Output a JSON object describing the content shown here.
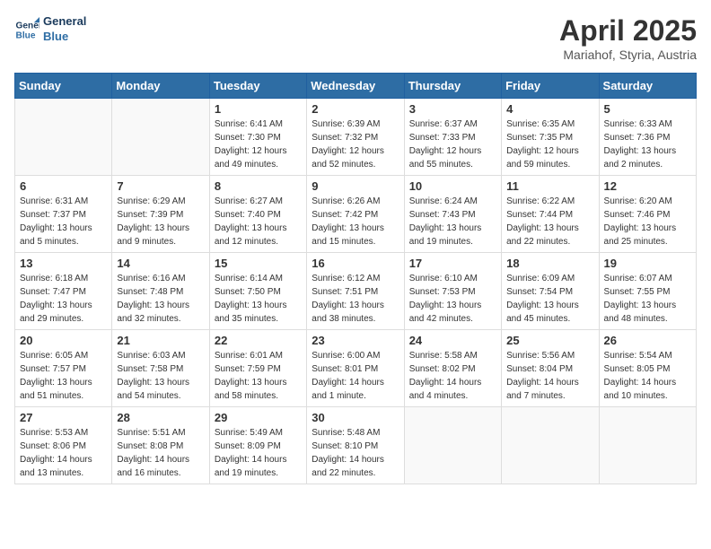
{
  "header": {
    "logo_line1": "General",
    "logo_line2": "Blue",
    "month": "April 2025",
    "location": "Mariahof, Styria, Austria"
  },
  "weekdays": [
    "Sunday",
    "Monday",
    "Tuesday",
    "Wednesday",
    "Thursday",
    "Friday",
    "Saturday"
  ],
  "weeks": [
    [
      {
        "day": "",
        "info": ""
      },
      {
        "day": "",
        "info": ""
      },
      {
        "day": "1",
        "info": "Sunrise: 6:41 AM\nSunset: 7:30 PM\nDaylight: 12 hours\nand 49 minutes."
      },
      {
        "day": "2",
        "info": "Sunrise: 6:39 AM\nSunset: 7:32 PM\nDaylight: 12 hours\nand 52 minutes."
      },
      {
        "day": "3",
        "info": "Sunrise: 6:37 AM\nSunset: 7:33 PM\nDaylight: 12 hours\nand 55 minutes."
      },
      {
        "day": "4",
        "info": "Sunrise: 6:35 AM\nSunset: 7:35 PM\nDaylight: 12 hours\nand 59 minutes."
      },
      {
        "day": "5",
        "info": "Sunrise: 6:33 AM\nSunset: 7:36 PM\nDaylight: 13 hours\nand 2 minutes."
      }
    ],
    [
      {
        "day": "6",
        "info": "Sunrise: 6:31 AM\nSunset: 7:37 PM\nDaylight: 13 hours\nand 5 minutes."
      },
      {
        "day": "7",
        "info": "Sunrise: 6:29 AM\nSunset: 7:39 PM\nDaylight: 13 hours\nand 9 minutes."
      },
      {
        "day": "8",
        "info": "Sunrise: 6:27 AM\nSunset: 7:40 PM\nDaylight: 13 hours\nand 12 minutes."
      },
      {
        "day": "9",
        "info": "Sunrise: 6:26 AM\nSunset: 7:42 PM\nDaylight: 13 hours\nand 15 minutes."
      },
      {
        "day": "10",
        "info": "Sunrise: 6:24 AM\nSunset: 7:43 PM\nDaylight: 13 hours\nand 19 minutes."
      },
      {
        "day": "11",
        "info": "Sunrise: 6:22 AM\nSunset: 7:44 PM\nDaylight: 13 hours\nand 22 minutes."
      },
      {
        "day": "12",
        "info": "Sunrise: 6:20 AM\nSunset: 7:46 PM\nDaylight: 13 hours\nand 25 minutes."
      }
    ],
    [
      {
        "day": "13",
        "info": "Sunrise: 6:18 AM\nSunset: 7:47 PM\nDaylight: 13 hours\nand 29 minutes."
      },
      {
        "day": "14",
        "info": "Sunrise: 6:16 AM\nSunset: 7:48 PM\nDaylight: 13 hours\nand 32 minutes."
      },
      {
        "day": "15",
        "info": "Sunrise: 6:14 AM\nSunset: 7:50 PM\nDaylight: 13 hours\nand 35 minutes."
      },
      {
        "day": "16",
        "info": "Sunrise: 6:12 AM\nSunset: 7:51 PM\nDaylight: 13 hours\nand 38 minutes."
      },
      {
        "day": "17",
        "info": "Sunrise: 6:10 AM\nSunset: 7:53 PM\nDaylight: 13 hours\nand 42 minutes."
      },
      {
        "day": "18",
        "info": "Sunrise: 6:09 AM\nSunset: 7:54 PM\nDaylight: 13 hours\nand 45 minutes."
      },
      {
        "day": "19",
        "info": "Sunrise: 6:07 AM\nSunset: 7:55 PM\nDaylight: 13 hours\nand 48 minutes."
      }
    ],
    [
      {
        "day": "20",
        "info": "Sunrise: 6:05 AM\nSunset: 7:57 PM\nDaylight: 13 hours\nand 51 minutes."
      },
      {
        "day": "21",
        "info": "Sunrise: 6:03 AM\nSunset: 7:58 PM\nDaylight: 13 hours\nand 54 minutes."
      },
      {
        "day": "22",
        "info": "Sunrise: 6:01 AM\nSunset: 7:59 PM\nDaylight: 13 hours\nand 58 minutes."
      },
      {
        "day": "23",
        "info": "Sunrise: 6:00 AM\nSunset: 8:01 PM\nDaylight: 14 hours\nand 1 minute."
      },
      {
        "day": "24",
        "info": "Sunrise: 5:58 AM\nSunset: 8:02 PM\nDaylight: 14 hours\nand 4 minutes."
      },
      {
        "day": "25",
        "info": "Sunrise: 5:56 AM\nSunset: 8:04 PM\nDaylight: 14 hours\nand 7 minutes."
      },
      {
        "day": "26",
        "info": "Sunrise: 5:54 AM\nSunset: 8:05 PM\nDaylight: 14 hours\nand 10 minutes."
      }
    ],
    [
      {
        "day": "27",
        "info": "Sunrise: 5:53 AM\nSunset: 8:06 PM\nDaylight: 14 hours\nand 13 minutes."
      },
      {
        "day": "28",
        "info": "Sunrise: 5:51 AM\nSunset: 8:08 PM\nDaylight: 14 hours\nand 16 minutes."
      },
      {
        "day": "29",
        "info": "Sunrise: 5:49 AM\nSunset: 8:09 PM\nDaylight: 14 hours\nand 19 minutes."
      },
      {
        "day": "30",
        "info": "Sunrise: 5:48 AM\nSunset: 8:10 PM\nDaylight: 14 hours\nand 22 minutes."
      },
      {
        "day": "",
        "info": ""
      },
      {
        "day": "",
        "info": ""
      },
      {
        "day": "",
        "info": ""
      }
    ]
  ]
}
